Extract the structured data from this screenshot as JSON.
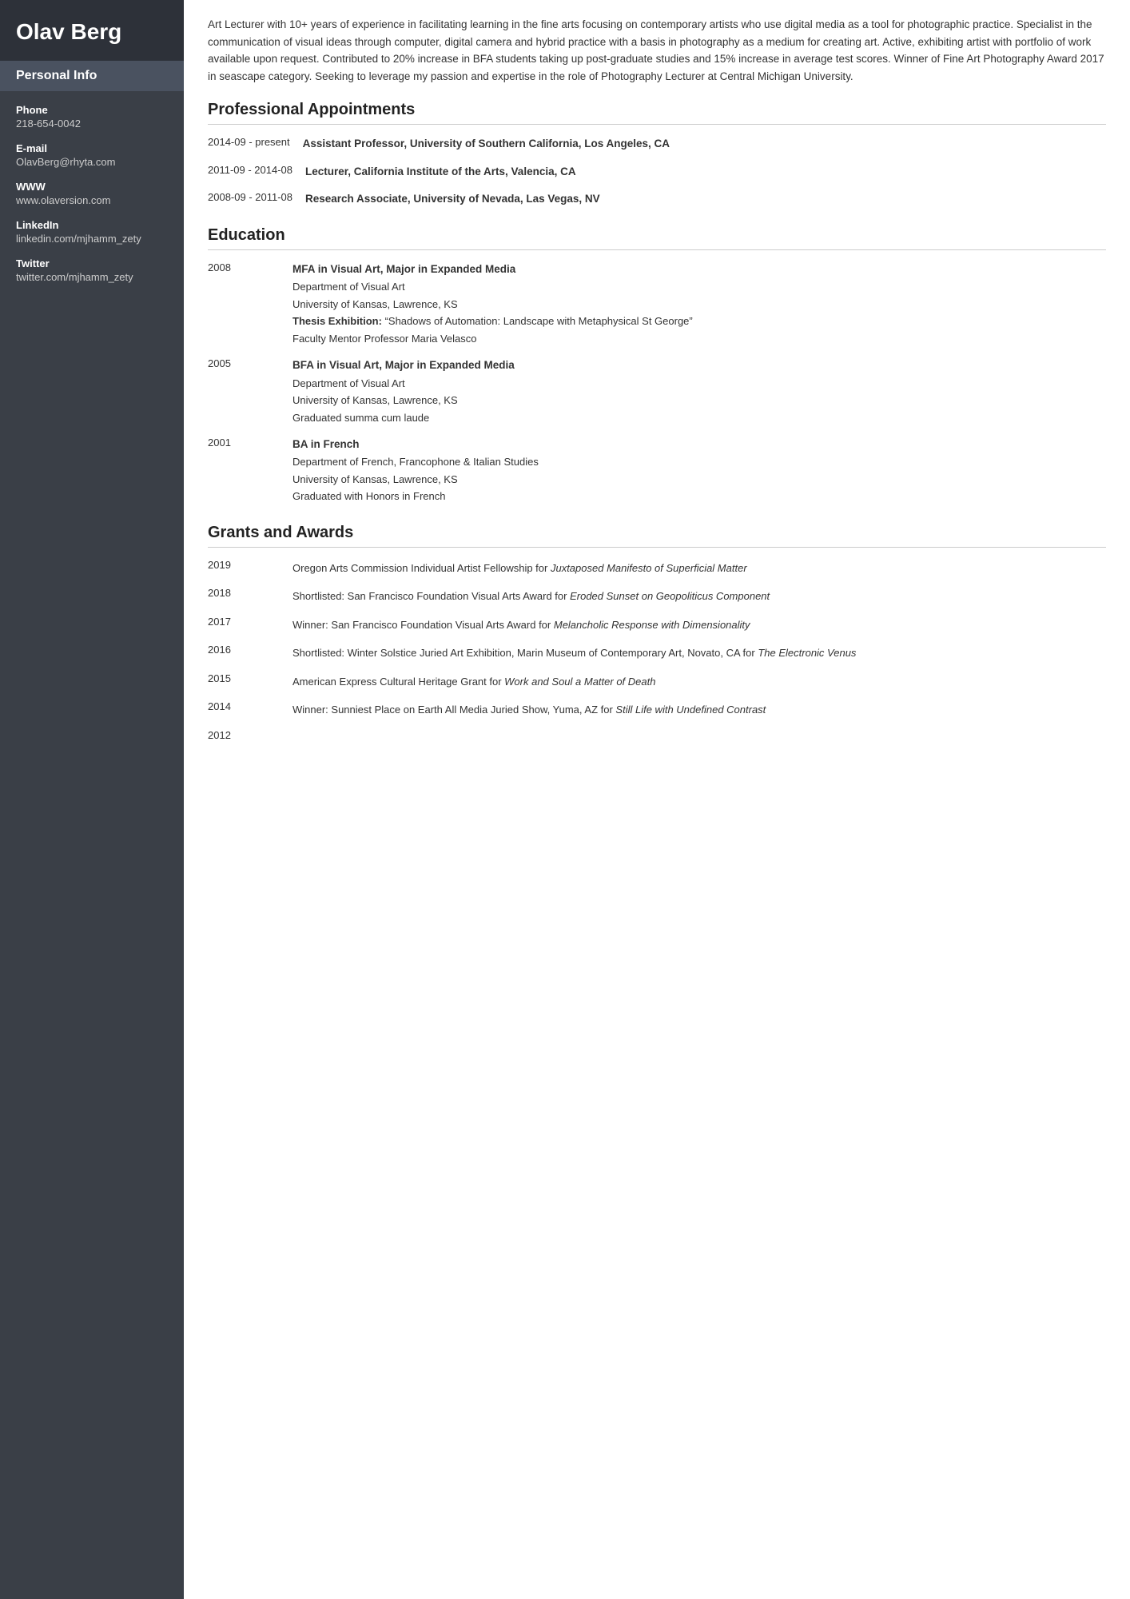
{
  "sidebar": {
    "name": "Olav Berg",
    "personal_info_label": "Personal Info",
    "items": [
      {
        "label": "Phone",
        "value": "218-654-0042"
      },
      {
        "label": "E-mail",
        "value": "OlavBerg@rhyta.com"
      },
      {
        "label": "WWW",
        "value": "www.olaversion.com"
      },
      {
        "label": "LinkedIn",
        "value": "linkedin.com/mjhamm_zety"
      },
      {
        "label": "Twitter",
        "value": "twitter.com/mjhamm_zety"
      }
    ]
  },
  "main": {
    "summary": "Art Lecturer with 10+ years of experience in facilitating learning in the fine arts focusing on contemporary artists who use digital media as a tool for photographic practice. Specialist in the communication of visual ideas through computer, digital camera and hybrid practice with a basis in photography as a medium for creating art. Active, exhibiting artist with portfolio of work available upon request. Contributed to 20% increase in BFA students taking up post-graduate studies and 15% increase in average test scores. Winner of Fine Art Photography Award 2017 in seascape category. Seeking to leverage my passion and expertise in the role of Photography Lecturer at Central Michigan University.",
    "sections": {
      "appointments": {
        "title": "Professional Appointments",
        "entries": [
          {
            "date": "2014-09 - present",
            "title": "Assistant Professor, University of Southern California, Los Angeles, CA",
            "details": []
          },
          {
            "date": "2011-09 - 2014-08",
            "title": "Lecturer, California Institute of the Arts, Valencia, CA",
            "details": []
          },
          {
            "date": "2008-09 - 2011-08",
            "title": "Research Associate, University of Nevada, Las Vegas, NV",
            "details": []
          }
        ]
      },
      "education": {
        "title": "Education",
        "entries": [
          {
            "date": "2008",
            "title": "MFA in Visual Art, Major in Expanded Media",
            "details": [
              {
                "text": "Department of Visual Art",
                "bold": false,
                "italic": false
              },
              {
                "text": "University of Kansas, Lawrence, KS",
                "bold": false,
                "italic": false
              },
              {
                "text": "Thesis Exhibition:",
                "bold": true,
                "italic": false,
                "suffix": " “Shadows of Automation: Landscape with Metaphysical St George”"
              },
              {
                "text": "Faculty Mentor Professor Maria Velasco",
                "bold": false,
                "italic": false
              }
            ]
          },
          {
            "date": "2005",
            "title": "BFA in Visual Art, Major in Expanded Media",
            "details": [
              {
                "text": "Department of Visual Art",
                "bold": false,
                "italic": false
              },
              {
                "text": "University of Kansas, Lawrence, KS",
                "bold": false,
                "italic": false
              },
              {
                "text": "Graduated summa cum laude",
                "bold": false,
                "italic": false
              }
            ]
          },
          {
            "date": "2001",
            "title": "BA in French",
            "details": [
              {
                "text": "Department of French, Francophone & Italian Studies",
                "bold": false,
                "italic": false
              },
              {
                "text": "University of Kansas, Lawrence, KS",
                "bold": false,
                "italic": false
              },
              {
                "text": "Graduated with Honors in French",
                "bold": false,
                "italic": false
              }
            ]
          }
        ]
      },
      "grants": {
        "title": "Grants and Awards",
        "entries": [
          {
            "date": "2019",
            "text": "Oregon Arts Commission Individual Artist Fellowship for ",
            "italic": "Juxtaposed Manifesto of Superficial Matter"
          },
          {
            "date": "2018",
            "text": "Shortlisted: San Francisco Foundation Visual Arts Award for ",
            "italic": "Eroded Sunset on Geopoliticus Component"
          },
          {
            "date": "2017",
            "text": "Winner: San Francisco Foundation Visual Arts Award for ",
            "italic": "Melancholic Response with Dimensionality"
          },
          {
            "date": "2016",
            "text": "Shortlisted: Winter Solstice Juried Art Exhibition, Marin Museum of Contemporary Art, Novato, CA for ",
            "italic": "The Electronic Venus"
          },
          {
            "date": "2015",
            "text": "American Express Cultural Heritage Grant for ",
            "italic": "Work and Soul a Matter of Death"
          },
          {
            "date": "2014",
            "text": "Winner: Sunniest Place on Earth All Media Juried Show, Yuma, AZ for ",
            "italic": "Still Life with Undefined Contrast"
          },
          {
            "date": "2012",
            "text": "",
            "italic": ""
          }
        ]
      }
    }
  }
}
